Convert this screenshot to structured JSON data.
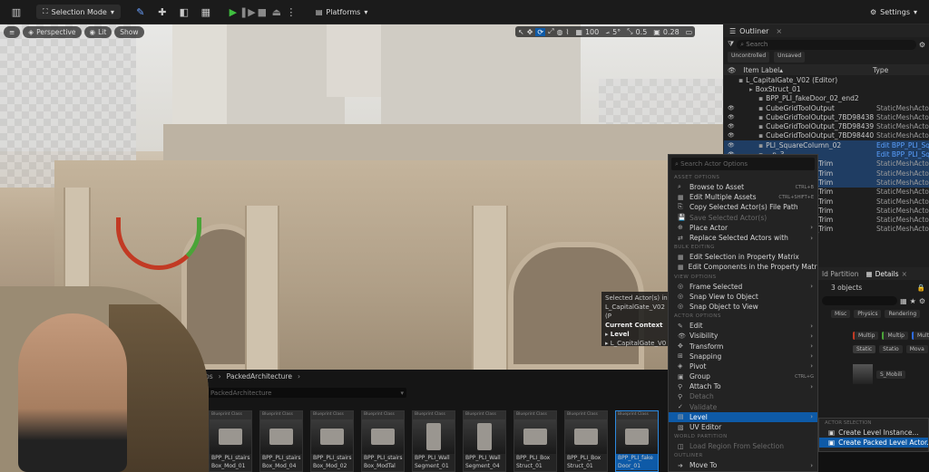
{
  "toolbar": {
    "mode": "Selection Mode",
    "platforms": "Platforms",
    "settings": "Settings"
  },
  "viewport": {
    "perspective": "Perspective",
    "lit": "Lit",
    "show": "Show",
    "grid_size": "100",
    "rotation": "5°",
    "scale": "0.5",
    "camera_speed": "0.28",
    "selected_actors": "Selected Actor(s) in:",
    "level_path": "L_CapitalGate_V02 (P",
    "current_context": "Current Context",
    "context_level": "Level",
    "context_level_value": "L_CapitalGate_V0"
  },
  "outliner": {
    "title": "Outliner",
    "search_placeholder": "Search",
    "filter_uncontrolled": "Uncontrolled",
    "filter_unsaved": "Unsaved",
    "col_label": "Item Label",
    "col_type": "Type",
    "rows": [
      {
        "label": "L_CapitalGate_V02 (Editor)",
        "type": "",
        "indent": 16
      },
      {
        "label": "BoxStruct_01",
        "type": "",
        "indent": 28
      },
      {
        "label": "BPP_PLI_fakeDoor_02_end2",
        "type": "",
        "indent": 38
      },
      {
        "label": "CubeGridToolOutput",
        "type": "StaticMeshActor",
        "indent": 38
      },
      {
        "label": "CubeGridToolOutput_7BD98438",
        "type": "StaticMeshActor",
        "indent": 38
      },
      {
        "label": "CubeGridToolOutput_7BD98439",
        "type": "StaticMeshActor",
        "indent": 38
      },
      {
        "label": "CubeGridToolOutput_7BD98440",
        "type": "StaticMeshActor",
        "indent": 38
      },
      {
        "label": "PLI_SquareColumn_02",
        "type": "Edit BPP_PLI_Squ",
        "indent": 38
      },
      {
        "label": "...n_3",
        "type": "Edit BPP_PLI_Squ",
        "indent": 38
      },
      {
        "label": "...ng_1st_Floor_Trim",
        "type": "StaticMeshActor",
        "indent": 38
      },
      {
        "label": "...ng_1st_Floor_Trim",
        "type": "StaticMeshActor",
        "indent": 38
      },
      {
        "label": "...ng_1st_Floor_Trim",
        "type": "StaticMeshActor",
        "indent": 38
      },
      {
        "label": "...ng_1st_Floor_Trim",
        "type": "StaticMeshActor",
        "indent": 38
      },
      {
        "label": "...ng_1st_Floor_Trim",
        "type": "StaticMeshActor",
        "indent": 38
      },
      {
        "label": "...ng_1st_Floor_Trim",
        "type": "StaticMeshActor",
        "indent": 38
      },
      {
        "label": "...ng_1st_Floor_Trim",
        "type": "StaticMeshActor",
        "indent": 38
      },
      {
        "label": "...ng_1st_Floor_Trim",
        "type": "StaticMeshActor",
        "indent": 38
      }
    ]
  },
  "details": {
    "world_partition": "ld Partition",
    "title": "Details",
    "count": "3 objects",
    "tab_misc": "Misc",
    "tab_physics": "Physics",
    "tab_rendering": "Rendering",
    "mobility": "Static",
    "mobility2": "Statio",
    "mobility3": "Mova",
    "multip": "Multip",
    "mesh": "S_Mobili"
  },
  "context_menu": {
    "search_placeholder": "Search Actor Options",
    "sections": {
      "asset": "ASSET OPTIONS",
      "bulk": "BULK EDITING",
      "view": "VIEW OPTIONS",
      "actor": "ACTOR OPTIONS",
      "world": "WORLD PARTITION",
      "outliner": "OUTLINER"
    },
    "asset_items": [
      {
        "label": "Browse to Asset",
        "key": "CTRL+B"
      },
      {
        "label": "Edit Multiple Assets",
        "key": "CTRL+SHIFT+E"
      },
      {
        "label": "Copy Selected Actor(s) File Path",
        "key": ""
      },
      {
        "label": "Save Selected Actor(s)",
        "key": ""
      },
      {
        "label": "Place Actor",
        "key": ""
      },
      {
        "label": "Replace Selected Actors with",
        "key": ""
      }
    ],
    "bulk_items": [
      {
        "label": "Edit Selection in Property Matrix"
      },
      {
        "label": "Edit Components in the Property Matrix"
      }
    ],
    "view_items": [
      {
        "label": "Frame Selected"
      },
      {
        "label": "Snap View to Object"
      },
      {
        "label": "Snap Object to View"
      }
    ],
    "actor_items": [
      {
        "label": "Edit"
      },
      {
        "label": "Visibility"
      },
      {
        "label": "Transform"
      },
      {
        "label": "Snapping"
      },
      {
        "label": "Pivot"
      },
      {
        "label": "Group",
        "key": "CTRL+G"
      },
      {
        "label": "Attach To"
      },
      {
        "label": "Detach"
      },
      {
        "label": "Validate"
      },
      {
        "label": "Level"
      },
      {
        "label": "UV Editor"
      }
    ],
    "world_items": [
      {
        "label": "Load Region From Selection"
      }
    ],
    "outliner_items": [
      {
        "label": "Move To"
      }
    ]
  },
  "level_submenu": {
    "section": "ACTOR SELECTION",
    "create_instance": "Create Level Instance...",
    "create_packed": "Create Packed Level Actor..."
  },
  "content_browser": {
    "breadcrumb_sep": "ps",
    "folder": "PackedArchitecture",
    "search": "PackedArchitecture",
    "tile_class": "Blueprint Class",
    "tiles": [
      {
        "name": "BPP_PLI_stairs",
        "name2": "Box_Mod_01"
      },
      {
        "name": "BPP_PLI_stairs",
        "name2": "Box_Mod_04"
      },
      {
        "name": "BPP_PLI_stairs",
        "name2": "Box_Mod_02"
      },
      {
        "name": "BPP_PLI_stairs",
        "name2": "Box_ModTal"
      },
      {
        "name": "BPP_PLI_Wall",
        "name2": "Segment_01"
      },
      {
        "name": "BPP_PLI_Wall",
        "name2": "Segment_04"
      },
      {
        "name": "BPP_PLI_Box",
        "name2": "Struct_01"
      },
      {
        "name": "BPP_PLI_Box",
        "name2": "Struct_01"
      },
      {
        "name": "BPP_PLI_fake",
        "name2": "Door_01"
      }
    ]
  }
}
